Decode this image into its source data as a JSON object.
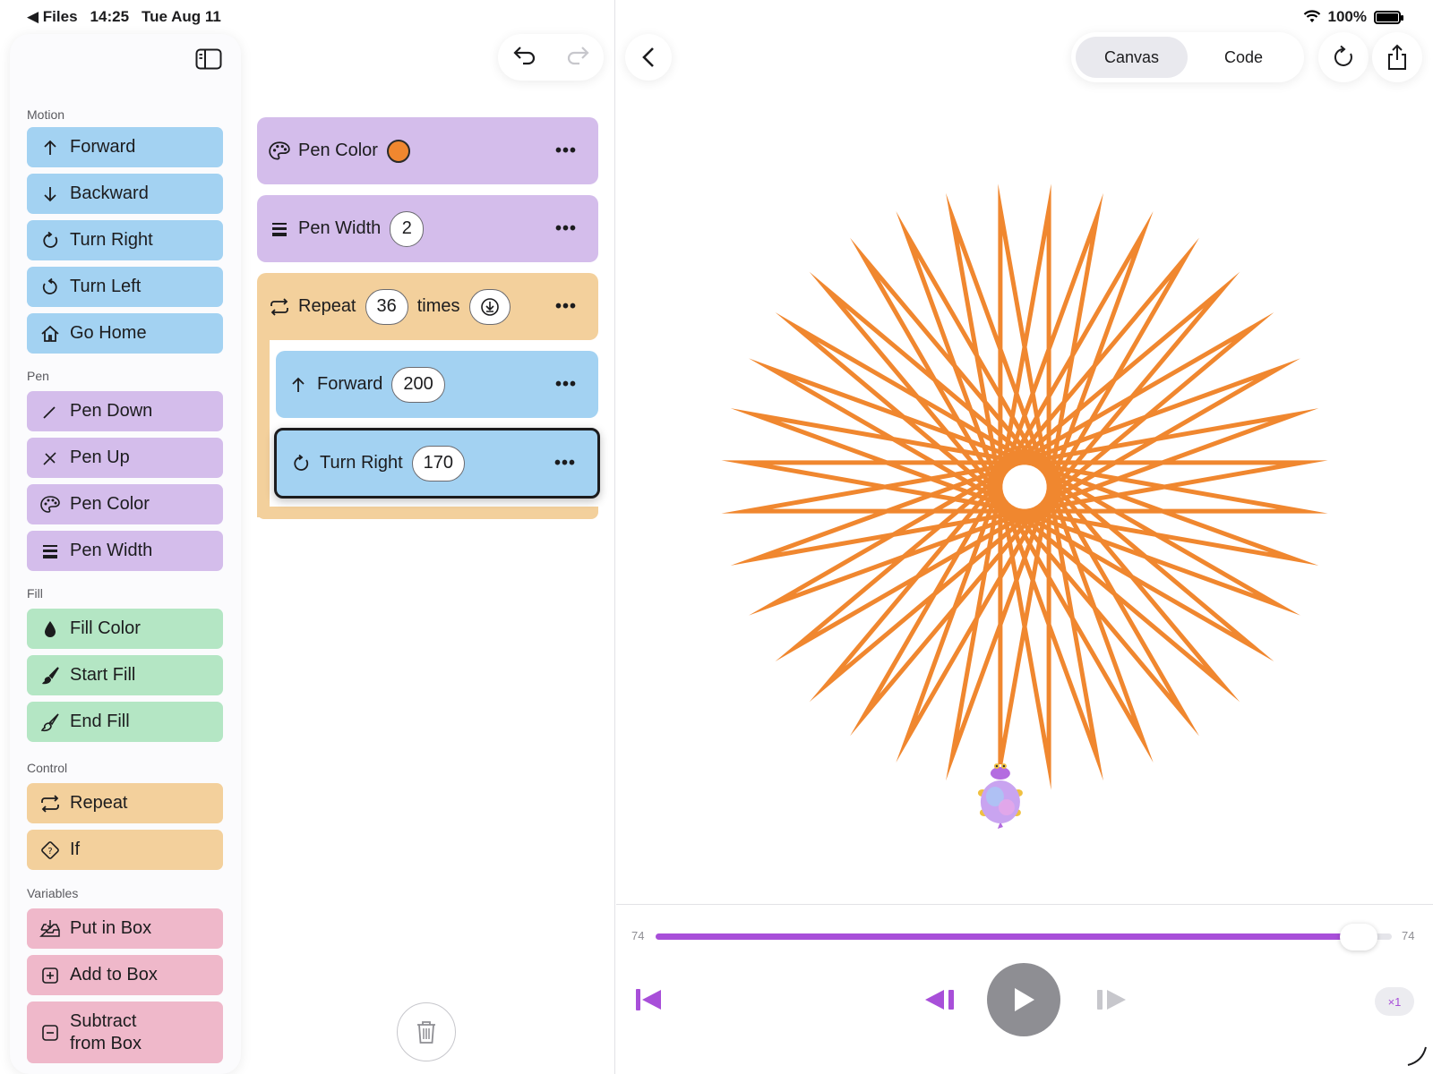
{
  "status": {
    "back_app": "Files",
    "time": "14:25",
    "date": "Tue Aug 11",
    "battery": "100%"
  },
  "palette": {
    "sections": {
      "motion": "Motion",
      "pen": "Pen",
      "fill": "Fill",
      "control": "Control",
      "variables": "Variables"
    },
    "motion": [
      "Forward",
      "Backward",
      "Turn Right",
      "Turn Left",
      "Go Home"
    ],
    "pen": [
      "Pen Down",
      "Pen Up",
      "Pen Color",
      "Pen Width"
    ],
    "fill": [
      "Fill Color",
      "Start Fill",
      "End Fill"
    ],
    "control": [
      "Repeat",
      "If"
    ],
    "variables": [
      "Put in Box",
      "Add to Box",
      "Subtract\nfrom Box"
    ]
  },
  "program": {
    "pen_color": {
      "label": "Pen Color",
      "color": "#f0872f"
    },
    "pen_width": {
      "label": "Pen Width",
      "value": "2"
    },
    "repeat": {
      "label": "Repeat",
      "count": "36",
      "suffix": "times"
    },
    "forward": {
      "label": "Forward",
      "value": "200"
    },
    "turn_right": {
      "label": "Turn Right",
      "value": "170"
    },
    "more": "•••"
  },
  "toolbar": {
    "canvas_tab": "Canvas",
    "code_tab": "Code",
    "active_tab": "Canvas"
  },
  "playback": {
    "start_label": "74",
    "end_label": "74",
    "progress": 0.955,
    "speed": "×1"
  },
  "drawing": {
    "steps": 36,
    "distance": 200,
    "turn": 170,
    "stroke_color": "#f0872f",
    "line_width": 2
  }
}
